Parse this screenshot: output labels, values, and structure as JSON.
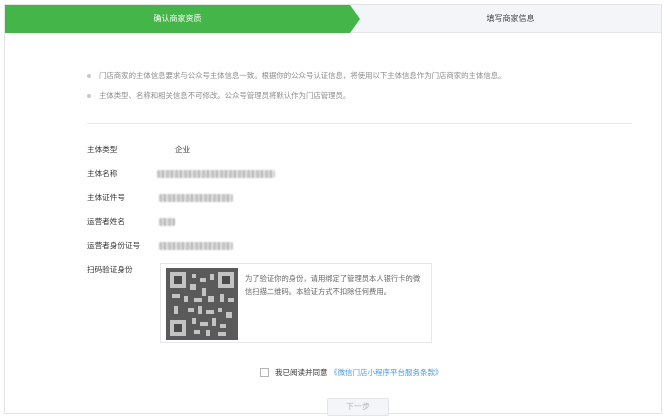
{
  "steps": {
    "step1": "确认商家资质",
    "step2": "填写商家信息"
  },
  "notices": [
    "门店商家的主体信息要求与公众号主体信息一致。根据你的公众号认证信息，将使用以下主体信息作为门店商家的主体信息。",
    "主体类型、名称和相关信息不可修改。公众号管理员将默认作为门店管理员。"
  ],
  "form": {
    "type_label": "主体类型",
    "type_value": "企业",
    "name_label": "主体名称",
    "cert_label": "主体证件号",
    "operator_label": "运营者姓名",
    "operator_id_label": "运营者身份证号",
    "scan_label": "扫码验证身份",
    "scan_hint": "为了验证你的身份，请用绑定了管理员本人银行卡的微信扫描二维码。本验证方式不扣除任何费用。"
  },
  "agree": {
    "text": "我已阅读并同意",
    "link": "《微信门店小程序平台服务条款》"
  },
  "next_button": "下一步",
  "colors": {
    "accent": "#44b549",
    "link": "#459ae9"
  }
}
